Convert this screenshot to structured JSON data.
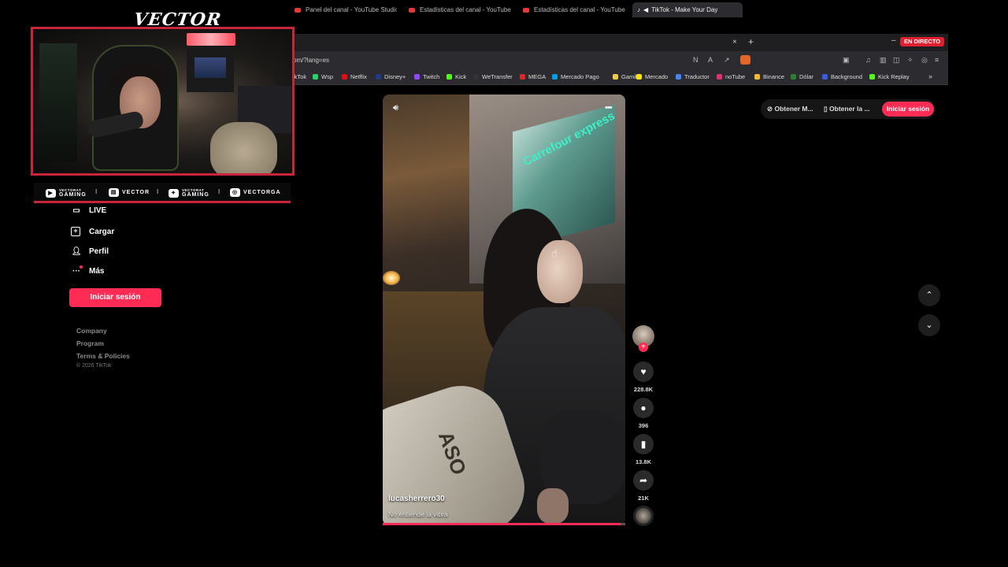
{
  "browser": {
    "tabs": [
      {
        "label": "Panel del canal - YouTube Studio"
      },
      {
        "label": "Estadísticas del canal - YouTube Studio"
      },
      {
        "label": "Estadísticas del canal - YouTube Studio"
      },
      {
        "label": "TikTok - Make Your Day"
      }
    ],
    "close_symbol": "×",
    "new_tab_symbol": "+",
    "minimize_symbol": "–",
    "url": "om/?lang=es",
    "bookmarks": [
      {
        "label": "ikTok"
      },
      {
        "label": "Wsp"
      },
      {
        "label": "Netflix"
      },
      {
        "label": "Disney+"
      },
      {
        "label": "Twitch"
      },
      {
        "label": "Kick"
      },
      {
        "label": "WeTransfer"
      },
      {
        "label": "MEGA"
      },
      {
        "label": "Mercado Pago"
      },
      {
        "label": "Gamil"
      },
      {
        "label": "Mercado"
      },
      {
        "label": "Traductor"
      },
      {
        "label": "noTube"
      },
      {
        "label": "Binance"
      },
      {
        "label": "Dólar"
      },
      {
        "label": "Background"
      },
      {
        "label": "Kick Replay"
      }
    ],
    "bookmarks_more": "»"
  },
  "overlay": {
    "live_badge": "EN DIRECTO",
    "brand": "VECTOR",
    "social": [
      {
        "icon": "youtube-icon",
        "top": "VECTORAT",
        "bottom": "GAMING"
      },
      {
        "icon": "twitch-icon",
        "label": "VECTOR"
      },
      {
        "icon": "twitter-icon",
        "top": "VECTORAT",
        "bottom": "GAMING"
      },
      {
        "icon": "instagram-icon",
        "label": "VECTORGA"
      }
    ],
    "separator": "I"
  },
  "nav": {
    "items": [
      {
        "label": "LIVE",
        "icon": "live-icon"
      },
      {
        "label": "Cargar",
        "icon": "upload-icon"
      },
      {
        "label": "Perfil",
        "icon": "profile-icon"
      },
      {
        "label": "Más",
        "icon": "more-icon"
      }
    ],
    "login": "Iniciar sesión",
    "footer": [
      "Company",
      "Program",
      "Terms & Policies"
    ],
    "copyright": "© 2026 TikTok"
  },
  "video": {
    "username": "lucasherrero30",
    "description": "No entiende la vibra",
    "progress": 0.98,
    "store_sign": "Carrefour express",
    "bag_text": "ASO"
  },
  "actions": {
    "likes": "228.8K",
    "comments": "396",
    "saves": "13.8K",
    "shares": "21K"
  },
  "topbar": {
    "get_app": "Obtener M...",
    "get_desktop": "Obtener la ...",
    "login": "Iniciar sesión"
  },
  "colors": {
    "accent": "#fe2c55",
    "overlay_border": "#c8243a",
    "live": "#e0202e"
  }
}
